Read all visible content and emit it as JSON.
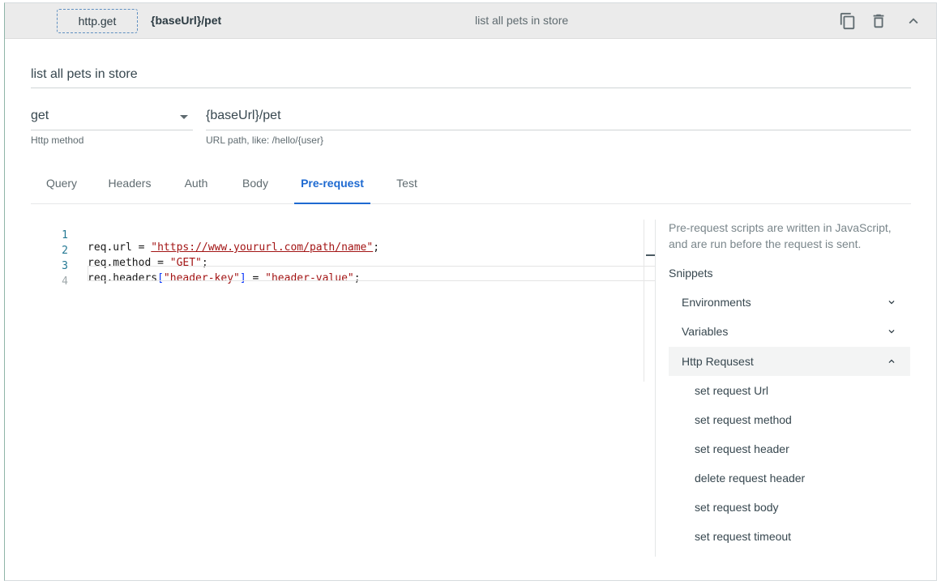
{
  "header": {
    "method_chip": "http.get",
    "url": "{baseUrl}/pet",
    "description": "list all pets in store",
    "icons": [
      "copy-icon",
      "trash-icon",
      "chevron-up-icon"
    ]
  },
  "form": {
    "description_value": "list all pets in store",
    "method_value": "get",
    "method_hint": "Http method",
    "url_value": "{baseUrl}/pet",
    "url_hint": "URL path, like: /hello/{user}"
  },
  "tabs": [
    {
      "label": "Query"
    },
    {
      "label": "Headers"
    },
    {
      "label": "Auth"
    },
    {
      "label": "Body"
    },
    {
      "label": "Pre-request"
    },
    {
      "label": "Test"
    }
  ],
  "active_tab": "Pre-request",
  "editor": {
    "line_numbers": [
      "1",
      "2",
      "3",
      "4"
    ],
    "line1": {
      "a": "req.url = ",
      "s": "\"https://www.yoururl.com/path/name\"",
      "b": ";"
    },
    "line2": {
      "a": "req.method = ",
      "s": "\"GET\"",
      "b": ";"
    },
    "line3": {
      "a": "req.headers",
      "o": "[",
      "s1": "\"header-key\"",
      "c": "]",
      "m": " = ",
      "s2": "\"header-value\"",
      "b": ";"
    }
  },
  "snippets": {
    "intro": "Pre-request scripts are written in JavaScript, and are run before the request is sent.",
    "title": "Snippets",
    "groups": [
      {
        "label": "Environments",
        "expanded": false
      },
      {
        "label": "Variables",
        "expanded": false
      },
      {
        "label": "Http Requsest",
        "expanded": true
      }
    ],
    "items": [
      "set request Url",
      "set request method",
      "set request header",
      "delete request header",
      "set request body",
      "set request timeout"
    ]
  },
  "colors": {
    "accent": "#1e6ad1",
    "string": "#a31515",
    "line_number": "#237893"
  }
}
